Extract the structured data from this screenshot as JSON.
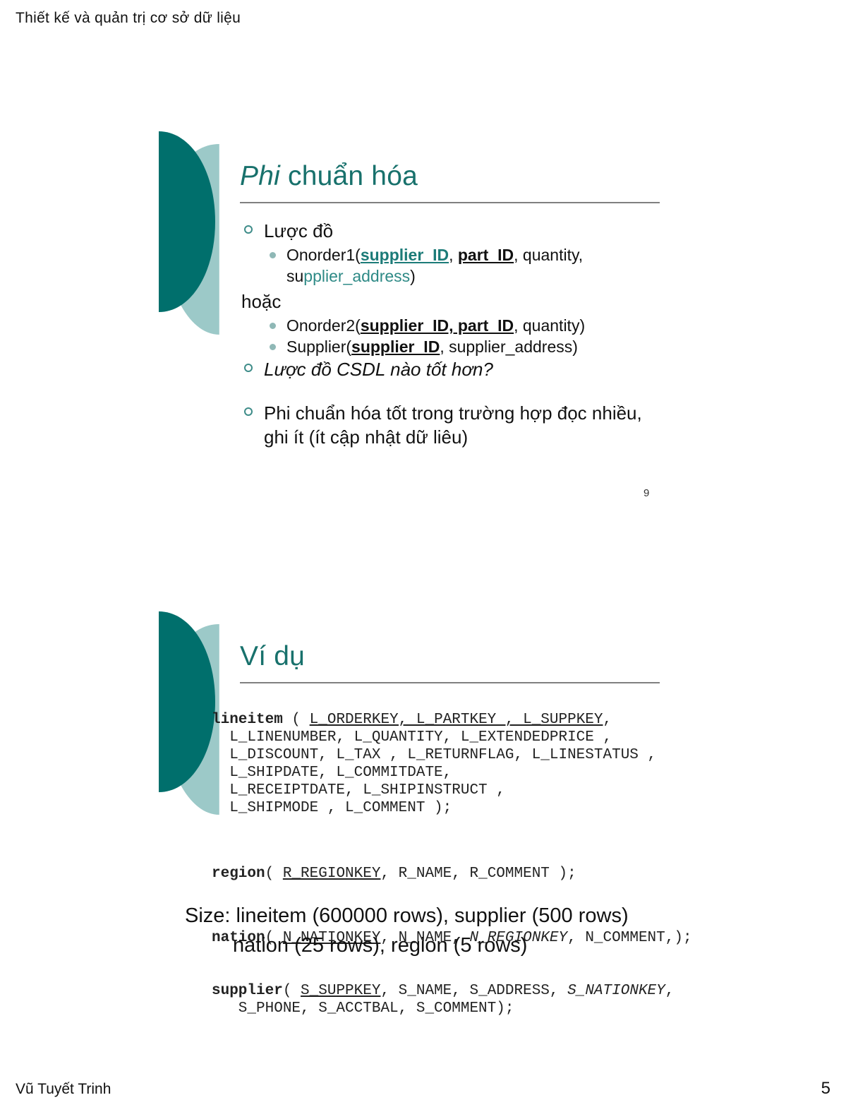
{
  "page": {
    "header": "Thiết kế và quản trị cơ sở dữ liệu",
    "footer_author": "Vũ Tuyết Trinh",
    "footer_page": "5"
  },
  "colors": {
    "teal_dark": "#006F6C",
    "teal_light": "#9CC9C8",
    "title_teal": "#18716C",
    "rule_gray": "#808080"
  },
  "slide1": {
    "title_italic": "Phi",
    "title_rest": " chuẩn hóa",
    "slide_number": "9",
    "bullet_schema": "Lược đồ",
    "onorder1": {
      "prefix": "Onorder1(",
      "key1": "supplier_ID",
      "sep1": ", ",
      "key2": "part_ID",
      "mid": ", quantity,",
      "line2_black": "su",
      "line2_teal": "pplier_address",
      "suffix": ")"
    },
    "hoac": "hoặc",
    "onorder2": {
      "prefix": "Onorder2(",
      "keys": "supplier_ID, part_ID",
      "suffix": ", quantity)"
    },
    "supplier": {
      "prefix": "Supplier(",
      "key": "supplier_ID",
      "suffix": ", supplier_address)"
    },
    "bullet_question": "Lược đồ CSDL nào tốt hơn?",
    "bullet_conclusion_l1": "Phi chuẩn hóa tốt trong trường hợp đọc nhiều,",
    "bullet_conclusion_l2": "ghi ít (ít cập nhật dữ liêu)"
  },
  "slide2": {
    "title": "Ví dụ",
    "tables": [
      {
        "name": "lineitem",
        "open": " ( ",
        "pk": "L_ORDERKEY, L_PARTKEY , L_SUPPKEY",
        "rest_lines": [
          "  L_LINENUMBER, L_QUANTITY, L_EXTENDEDPRICE ,",
          "  L_DISCOUNT, L_TAX , L_RETURNFLAG, L_LINESTATUS ,",
          "  L_SHIPDATE, L_COMMITDATE,",
          "  L_RECEIPTDATE, L_SHIPINSTRUCT ,",
          "  L_SHIPMODE , L_COMMENT );"
        ],
        "first_line_tail": ","
      },
      {
        "name": "region",
        "open": "( ",
        "pk": "R_REGIONKEY",
        "tail": ", R_NAME, R_COMMENT );"
      },
      {
        "name": "nation",
        "open": "( ",
        "pk": "N_NATIONKEY",
        "mid": ", N_NAME, ",
        "fk": "N_REGIONKEY",
        "tail": ", N_COMMENT,);"
      },
      {
        "name": "supplier",
        "open": "( ",
        "pk": "S_SUPPKEY",
        "mid": ", S_NAME, S_ADDRESS, ",
        "fk": "S_NATIONKEY",
        "tail": ",",
        "line2": "   S_PHONE, S_ACCTBAL, S_COMMENT);"
      }
    ],
    "size_line1": "Size: lineitem (600000 rows), supplier (500 rows)",
    "size_line2": "nation (25 rows), region (5 rows)"
  }
}
